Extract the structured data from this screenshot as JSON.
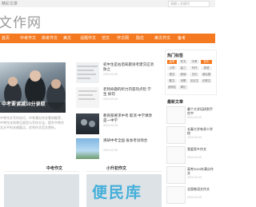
{
  "header": {
    "top_text": "精彩文章",
    "search_placeholder": "请输入关键词",
    "logo": "文作网"
  },
  "nav": [
    "首页",
    "中考作文",
    "高考作文",
    "美文",
    "话题作文",
    "范文",
    "作文网",
    "励志",
    "美文作文",
    "备考"
  ],
  "hero": {
    "caption": "中考要读减10分录取",
    "desc": "中考作文写作技巧，中考满分作文素材推荐，中考作文的常见类型与写作方法，提升中考作文水平的关键要点，优秀作文范文赏析。"
  },
  "articles": [
    {
      "title": "初中生是右后知题语考建交应消防之",
      "date": "2024-03-05"
    },
    {
      "title": "老师命题的听力内容热点检 学生 如何",
      "date": "2024-03-05"
    },
    {
      "title": "教育部要求中考 取消 中学课改是一中学",
      "date": "2024-03-05"
    },
    {
      "title": "清研中考全国 省会考试场合",
      "date": "2024-03-05"
    }
  ],
  "sections": {
    "left": "中考作文",
    "right": "小升初作文"
  },
  "watermark": "便民库",
  "sidebar": {
    "tags_title": "热门标签",
    "tags": [
      "高考",
      "作文",
      "中考",
      "初中",
      "小学",
      "高三",
      "写作",
      "英语",
      "语文",
      "阅读",
      "日记",
      "读后感",
      "散文",
      "诗歌",
      "议论文",
      "记叙文",
      "说明文",
      "周记"
    ],
    "latest_title": "最新文章",
    "latest": [
      {
        "title": "最个大学培研到手在中",
        "date": "2024-03-05"
      },
      {
        "title": "长春大学有多少学校",
        "date": "2024-03-05"
      },
      {
        "title": "我爱家乡作文",
        "date": "2024-03-05"
      },
      {
        "title": "高考2024年满分作文",
        "date": "2024-03-05"
      },
      {
        "title": "全国卷语文作文",
        "date": "2024-03-05"
      }
    ]
  },
  "colors": {
    "accent": "#f47920",
    "watermark": "#2aa7d8"
  }
}
